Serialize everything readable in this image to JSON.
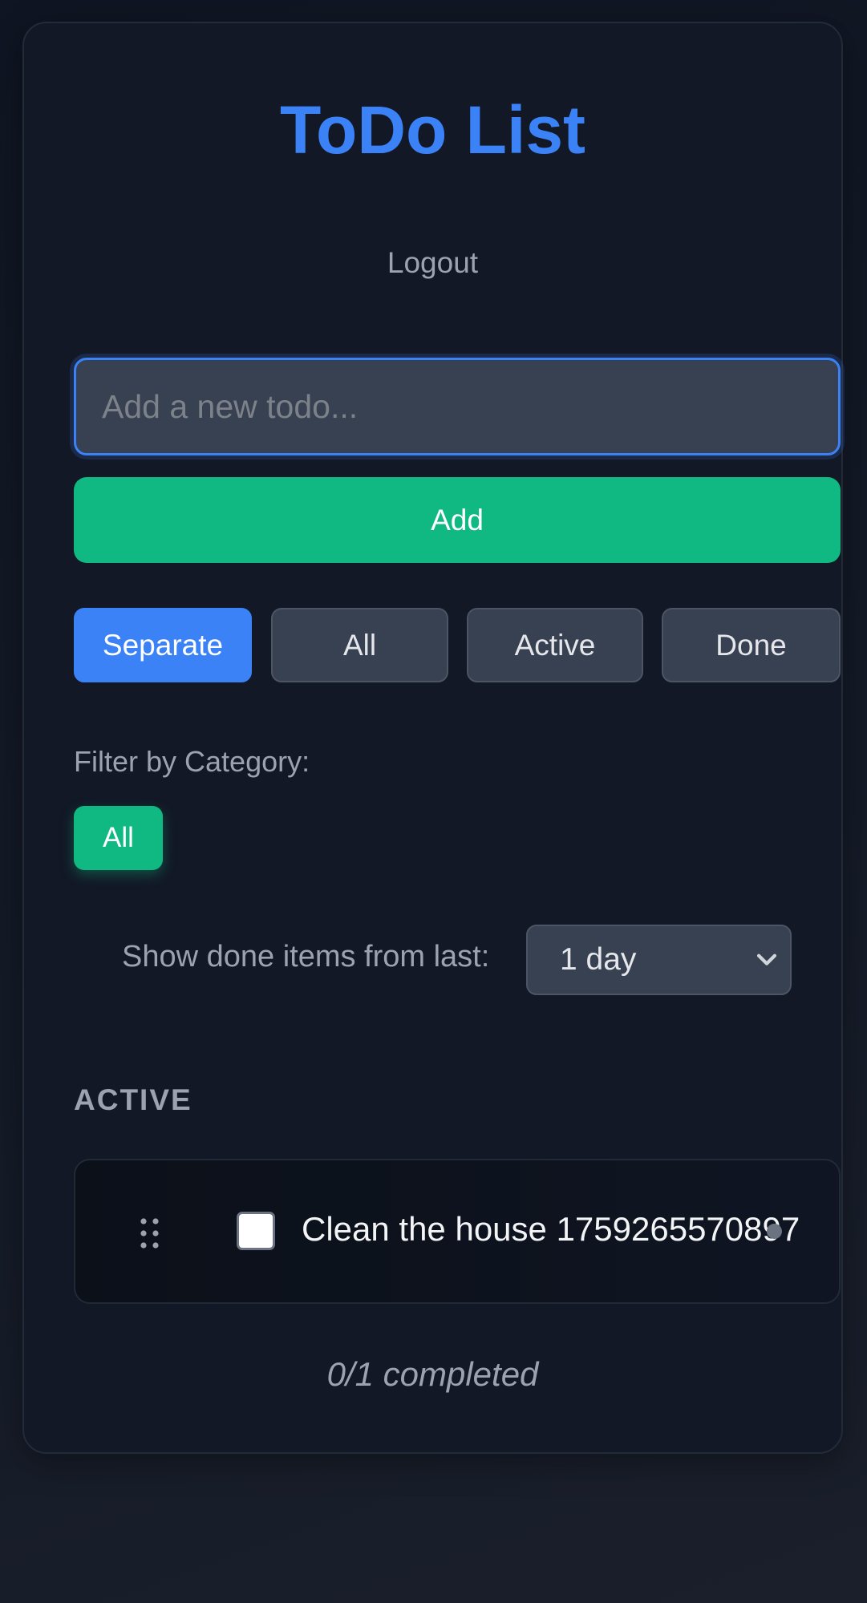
{
  "app": {
    "title": "ToDo List",
    "logout_label": "Logout"
  },
  "new_todo": {
    "placeholder": "Add a new todo...",
    "value": "",
    "add_label": "Add"
  },
  "view_tabs": [
    {
      "label": "Separate",
      "selected": true
    },
    {
      "label": "All",
      "selected": false
    },
    {
      "label": "Active",
      "selected": false
    },
    {
      "label": "Done",
      "selected": false
    }
  ],
  "category_filter": {
    "label": "Filter by Category:",
    "chips": [
      {
        "label": "All",
        "selected": true
      }
    ]
  },
  "done_period": {
    "label": "Show done items from last:",
    "selected": "1 day"
  },
  "sections": [
    {
      "header": "ACTIVE",
      "items": [
        {
          "text": "Clean the house 1759265570897",
          "done": false
        }
      ]
    }
  ],
  "summary": {
    "progress_text": "0/1 completed"
  },
  "icons": {
    "drag": "drag-handle-icon",
    "select": "chevron-down-icon"
  },
  "colors": {
    "accent_blue": "#3b82f6",
    "accent_green": "#10b981",
    "background": "#121826",
    "surface": "#374151"
  }
}
